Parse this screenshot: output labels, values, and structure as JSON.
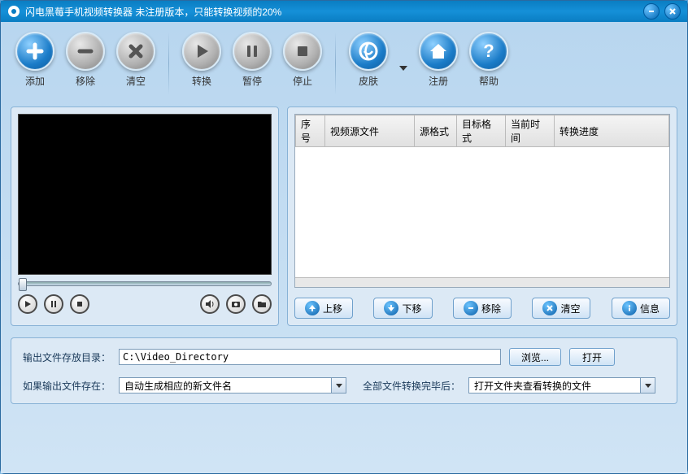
{
  "titlebar": {
    "title": "闪电黑莓手机视频转换器   未注册版本，只能转换视频的20%"
  },
  "toolbar": {
    "add": "添加",
    "remove": "移除",
    "clear": "清空",
    "convert": "转换",
    "pause": "暂停",
    "stop": "停止",
    "skin": "皮肤",
    "register": "注册",
    "help": "帮助"
  },
  "table": {
    "columns": [
      "序号",
      "视频源文件",
      "源格式",
      "目标格式",
      "当前时间",
      "转换进度"
    ]
  },
  "listButtons": {
    "up": "上移",
    "down": "下移",
    "remove": "移除",
    "clear": "清空",
    "info": "信息"
  },
  "bottom": {
    "outputDirLabel": "输出文件存放目录：",
    "outputDirValue": "C:\\Video_Directory",
    "browse": "浏览...",
    "open": "打开",
    "ifExistsLabel": "如果输出文件存在：",
    "ifExistsValue": "自动生成相应的新文件名",
    "afterAllLabel": "全部文件转换完毕后：",
    "afterAllValue": "打开文件夹查看转换的文件"
  }
}
